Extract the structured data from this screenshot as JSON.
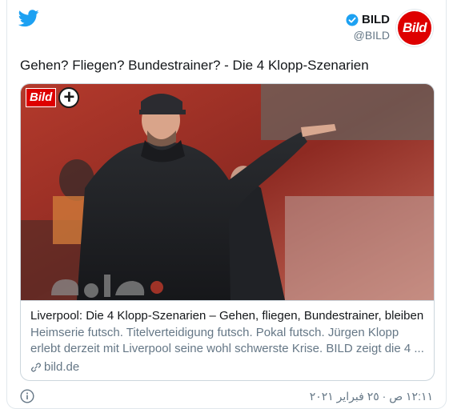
{
  "author": {
    "name": "BILD",
    "handle": "@BILD",
    "avatar_text": "Bild"
  },
  "tweet": {
    "text": "Gehen? Fliegen? Bundestrainer? - Die 4 Klopp-Szenarien"
  },
  "card": {
    "badge_logo": "Bild",
    "badge_plus": "+",
    "title": "Liverpool: Die 4 Klopp-Szenarien – Gehen, fliegen, Bundestrainer, bleiben?",
    "description": "Heimserie futsch. Titelverteidigung futsch. Pokal futsch. Jürgen Klopp erlebt derzeit mit Liverpool seine wohl schwerste Krise. BILD zeigt die 4 ...",
    "domain": "bild.de"
  },
  "footer": {
    "timestamp": "١٢:١١ ص · ٢٥ فبراير ٢٠٢١"
  },
  "colors": {
    "twitter_blue": "#1da1f2",
    "bild_red": "#de0000",
    "muted": "#657786"
  },
  "icons": [
    "twitter-bird-icon",
    "verified-icon",
    "link-icon",
    "info-icon"
  ]
}
